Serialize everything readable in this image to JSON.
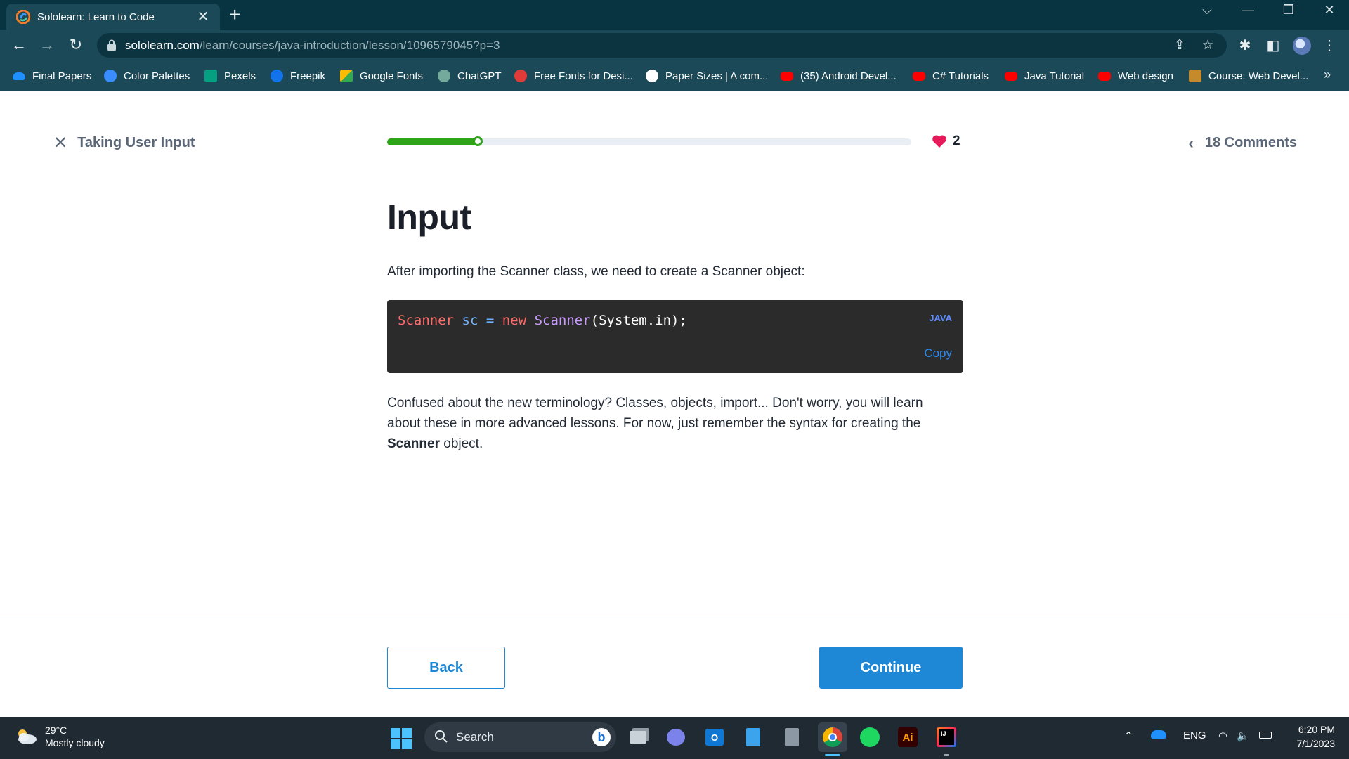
{
  "browser": {
    "tab_title": "Sololearn: Learn to Code",
    "url_host": "sololearn.com",
    "url_path": "/learn/courses/java-introduction/lesson/1096579045?p=3",
    "bookmarks": [
      {
        "label": "Final Papers",
        "icon": "onedrive-icon",
        "color": "#1e90ff"
      },
      {
        "label": "Color Palettes",
        "icon": "coolors-icon",
        "color": "#3a8dff"
      },
      {
        "label": "Pexels",
        "icon": "pexels-icon",
        "color": "#05a081"
      },
      {
        "label": "Freepik",
        "icon": "freepik-icon",
        "color": "#1273eb"
      },
      {
        "label": "Google Fonts",
        "icon": "google-fonts-icon",
        "color": "#fbbc04"
      },
      {
        "label": "ChatGPT",
        "icon": "chatgpt-icon",
        "color": "#74aa9c"
      },
      {
        "label": "Free Fonts for Desi...",
        "icon": "fonts-site-icon",
        "color": "#e03a3a"
      },
      {
        "label": "Paper Sizes | A com...",
        "icon": "paper-sizes-icon",
        "color": "#ffffff"
      },
      {
        "label": "(35) Android Devel...",
        "icon": "youtube-icon",
        "color": "#ff0000"
      },
      {
        "label": "C# Tutorials",
        "icon": "youtube-icon",
        "color": "#ff0000"
      },
      {
        "label": "Java Tutorial",
        "icon": "youtube-icon",
        "color": "#ff0000"
      },
      {
        "label": "Web design",
        "icon": "youtube-icon",
        "color": "#ff0000"
      },
      {
        "label": "Course: Web Devel...",
        "icon": "course-icon",
        "color": "#c48a2c"
      }
    ],
    "bookmarks_more": "»"
  },
  "lesson": {
    "back_to_label": "Taking User Input",
    "progress": 0.18,
    "hearts": "2",
    "comments_label": "18 Comments",
    "title": "Input",
    "intro": "After importing the Scanner class, we need to create a Scanner object:",
    "code": {
      "language": "JAVA",
      "copy_label": "Copy",
      "tokens": {
        "type": "Scanner",
        "var": "sc",
        "op": "=",
        "kw": "new",
        "cls": "Scanner",
        "rest": "(System.in);"
      }
    },
    "body_before": "Confused about the new terminology? Classes, objects, import... Don't worry, you will learn about these in more advanced lessons. For now, just remember the syntax for creating the ",
    "body_bold": "Scanner",
    "body_after": " object.",
    "back_button": "Back",
    "continue_button": "Continue"
  },
  "taskbar": {
    "temperature": "29°C",
    "condition": "Mostly cloudy",
    "search_label": "Search",
    "language": "ENG",
    "time": "6:20 PM",
    "date": "7/1/2023",
    "accent": "#4cc2ff"
  },
  "colors": {
    "brand_blue": "#1e88d6",
    "progress_green": "#2fa319",
    "heart_red": "#e8195a",
    "chrome_dark": "#083441"
  }
}
